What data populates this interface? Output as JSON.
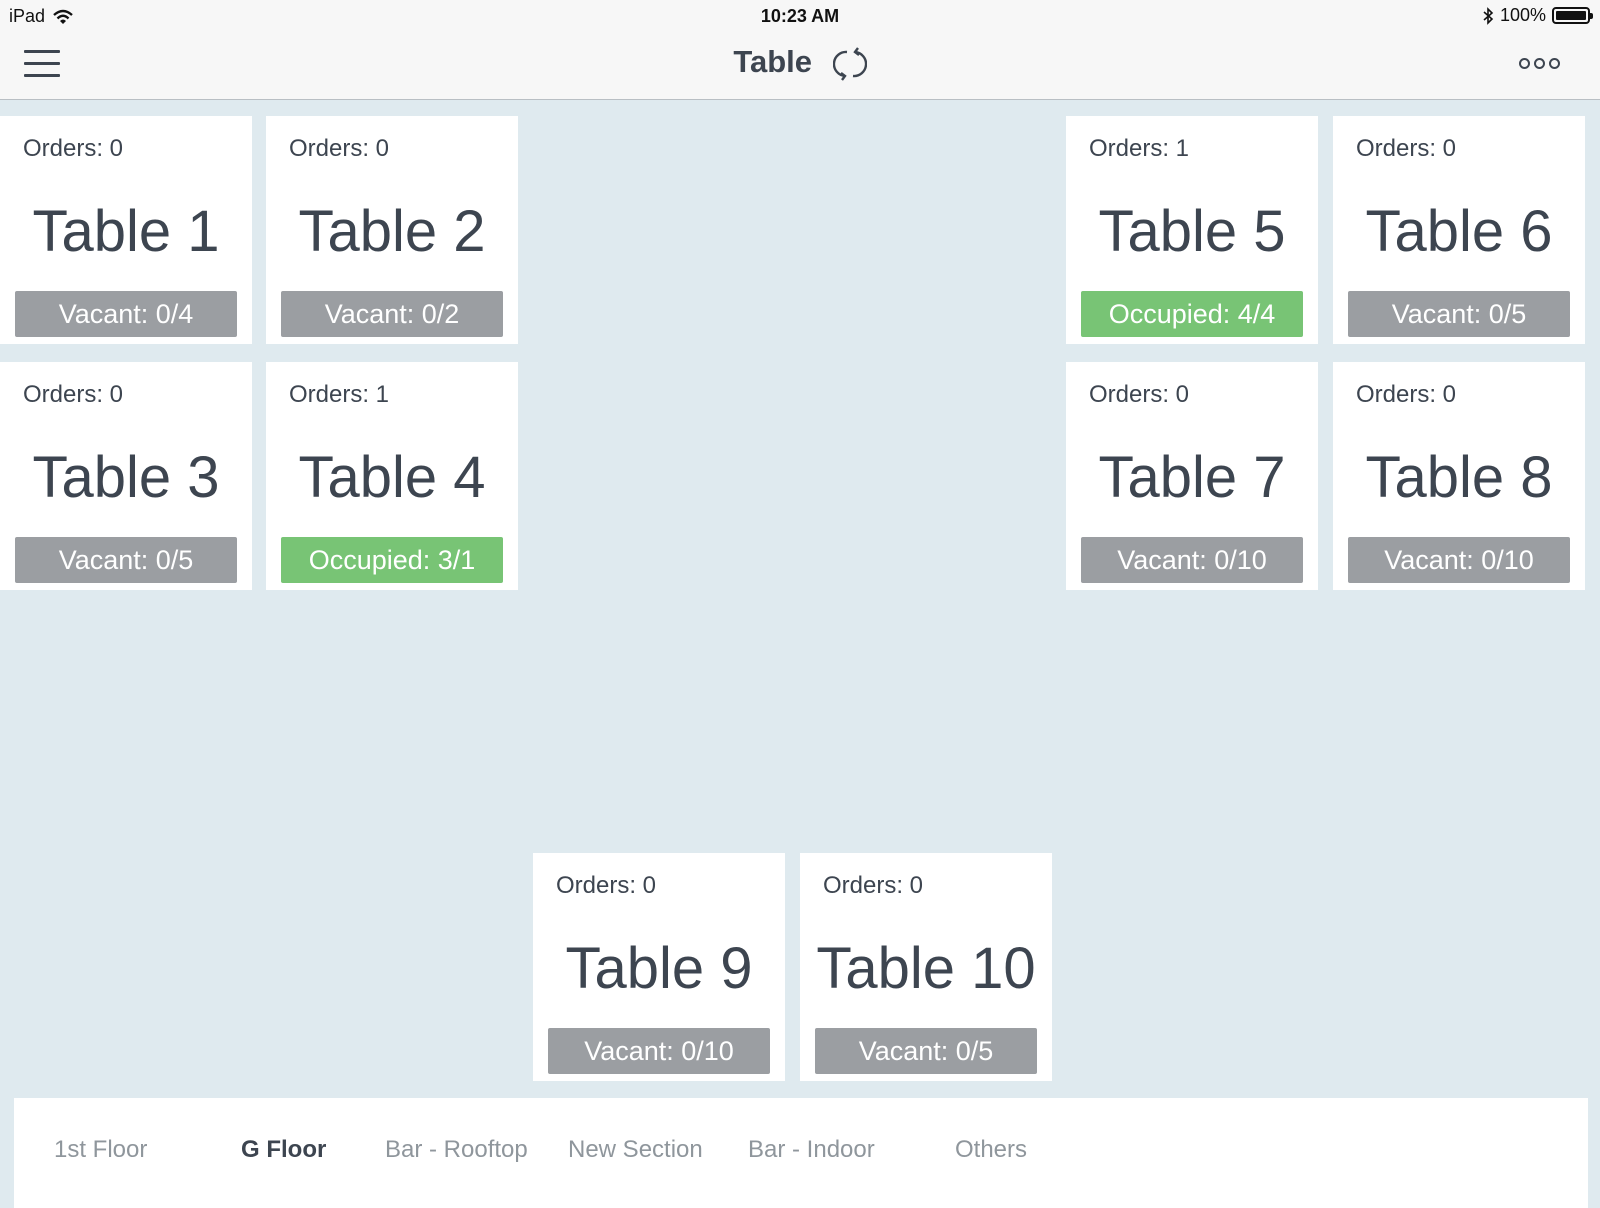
{
  "status_bar": {
    "device": "iPad",
    "time": "10:23 AM",
    "battery": "100%",
    "icons": [
      "wifi-icon",
      "bluetooth-icon",
      "battery-icon"
    ]
  },
  "header": {
    "title": "Table",
    "icons": [
      "menu-icon",
      "refresh-icon",
      "more-icon"
    ]
  },
  "colors": {
    "background": "#dfeaef",
    "vacant": "#9b9ea2",
    "occupied": "#78c475",
    "text": "#3d4550",
    "tab_active": "#3d4550",
    "tab_inactive": "#8f969c"
  },
  "tables": [
    {
      "orders": "Orders: 0",
      "name": "Table 1",
      "status": "Vacant: 0/4",
      "state": "vacant"
    },
    {
      "orders": "Orders: 0",
      "name": "Table 2",
      "status": "Vacant: 0/2",
      "state": "vacant"
    },
    {
      "orders": "Orders: 0",
      "name": "Table 3",
      "status": "Vacant: 0/5",
      "state": "vacant"
    },
    {
      "orders": "Orders: 1",
      "name": "Table 4",
      "status": "Occupied: 3/1",
      "state": "occupied"
    },
    {
      "orders": "Orders: 1",
      "name": "Table 5",
      "status": "Occupied: 4/4",
      "state": "occupied"
    },
    {
      "orders": "Orders: 0",
      "name": "Table 6",
      "status": "Vacant: 0/5",
      "state": "vacant"
    },
    {
      "orders": "Orders: 0",
      "name": "Table 7",
      "status": "Vacant: 0/10",
      "state": "vacant"
    },
    {
      "orders": "Orders: 0",
      "name": "Table 8",
      "status": "Vacant: 0/10",
      "state": "vacant"
    },
    {
      "orders": "Orders: 0",
      "name": "Table 9",
      "status": "Vacant: 0/10",
      "state": "vacant"
    },
    {
      "orders": "Orders: 0",
      "name": "Table 10",
      "status": "Vacant: 0/5",
      "state": "vacant"
    }
  ],
  "sections": [
    {
      "label": "1st Floor",
      "active": false
    },
    {
      "label": "G Floor",
      "active": true
    },
    {
      "label": "Bar - Rooftop",
      "active": false
    },
    {
      "label": "New Section",
      "active": false
    },
    {
      "label": "Bar - Indoor",
      "active": false
    },
    {
      "label": "Others",
      "active": false
    }
  ]
}
